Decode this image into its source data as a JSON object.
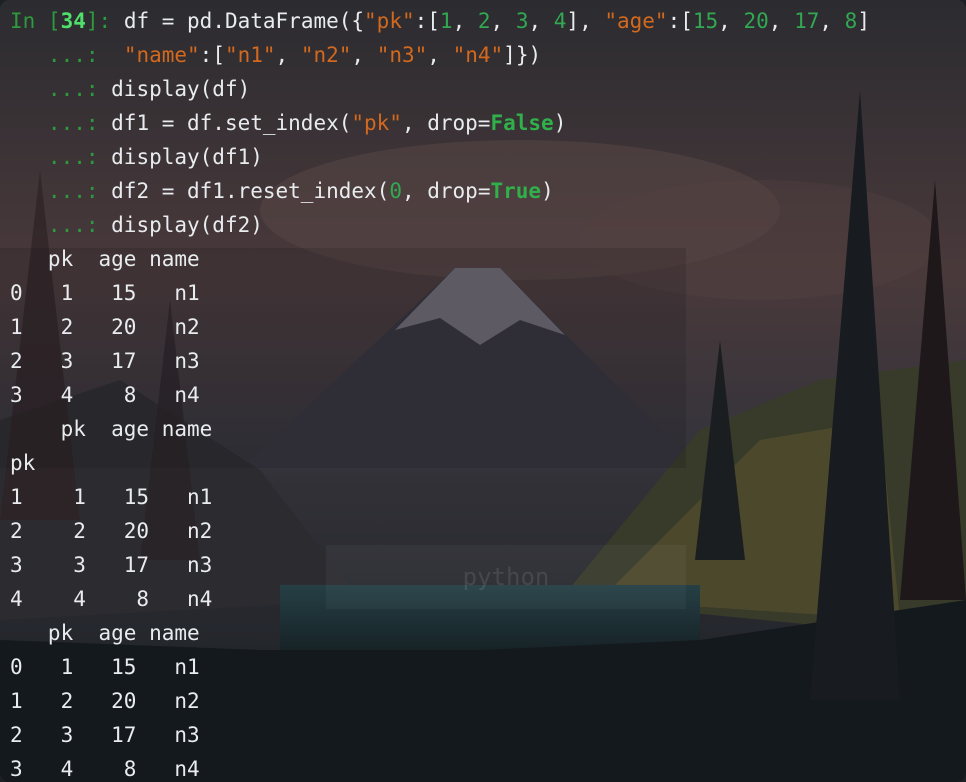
{
  "prompt": {
    "in_label": "In [",
    "number": "34",
    "in_close": "]: ",
    "continuation": "   ...: "
  },
  "code": {
    "l1": [
      "df = pd.DataFrame({",
      "\"pk\"",
      ":[",
      "1",
      ", ",
      "2",
      ", ",
      "3",
      ", ",
      "4",
      "], ",
      "\"age\"",
      ":[",
      "15",
      ", ",
      "20",
      ", ",
      "17",
      ", ",
      "8",
      "]"
    ],
    "l2": [
      " ",
      "\"name\"",
      ":[",
      "\"n1\"",
      ", ",
      "\"n2\"",
      ", ",
      "\"n3\"",
      ", ",
      "\"n4\"",
      "]})"
    ],
    "l3": "display(df)",
    "l4": [
      "df1 = df.set_index(",
      "\"pk\"",
      ", drop=",
      "False",
      ")"
    ],
    "l5": "display(df1)",
    "l6": [
      "df2 = df1.reset_index(",
      "0",
      ", drop=",
      "True",
      ")"
    ],
    "l7": "display(df2)"
  },
  "outputs": [
    {
      "rows": [
        "   pk  age name",
        "0   1   15   n1",
        "1   2   20   n2",
        "2   3   17   n3",
        "3   4    8   n4"
      ]
    },
    {
      "rows": [
        "    pk  age name",
        "pk",
        "1    1   15   n1",
        "2    2   20   n2",
        "3    3   17   n3",
        "4    4    8   n4"
      ]
    },
    {
      "rows": [
        "   pk  age name",
        "0   1   15   n1",
        "1   2   20   n2",
        "2   3   17   n3",
        "3   4    8   n4"
      ]
    }
  ],
  "watermark": "python",
  "colors": {
    "prompt": "#2e9a3e",
    "string": "#d2691e",
    "number": "#32a852",
    "keyword": "#2fb04a"
  }
}
